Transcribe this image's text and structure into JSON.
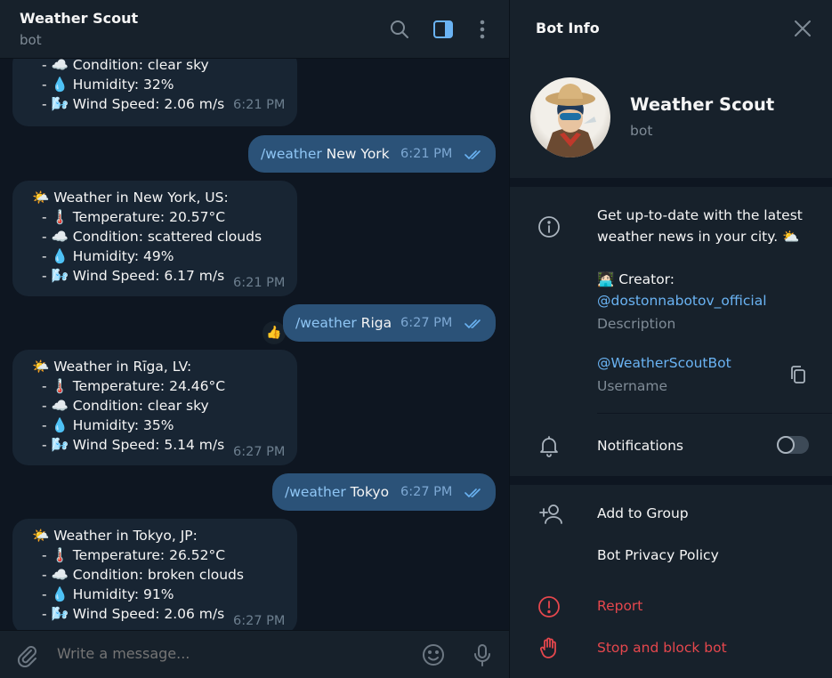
{
  "chat_header": {
    "title": "Weather Scout",
    "subtitle": "bot"
  },
  "messages": {
    "m0": {
      "lines": [
        "- ☁️ Condition: clear sky",
        "- 💧 Humidity: 32%",
        "- 🌬️ Wind Speed: 2.06 m/s"
      ],
      "time": "6:21 PM"
    },
    "m1": {
      "command": "/weather",
      "arg": " New York",
      "time": "6:21 PM"
    },
    "m2": {
      "lines": [
        "🌤️ Weather in New York, US:",
        "- 🌡️ Temperature: 20.57°C",
        "- ☁️ Condition: scattered clouds",
        "- 💧 Humidity: 49%",
        "- 🌬️ Wind Speed: 6.17 m/s"
      ],
      "time": "6:21 PM"
    },
    "m3": {
      "command": "/weather",
      "arg": " Riga",
      "time": "6:27 PM",
      "reaction": "👍"
    },
    "m4": {
      "lines": [
        "🌤️ Weather in Rīga, LV:",
        "- 🌡️ Temperature: 24.46°C",
        "- ☁️ Condition: clear sky",
        "- 💧 Humidity: 35%",
        "- 🌬️ Wind Speed: 5.14 m/s"
      ],
      "time": "6:27 PM"
    },
    "m5": {
      "command": "/weather",
      "arg": " Tokyo",
      "time": "6:27 PM"
    },
    "m6": {
      "lines": [
        "🌤️ Weather in Tokyo, JP:",
        "- 🌡️ Temperature: 26.52°C",
        "- ☁️ Condition: broken clouds",
        "- 💧 Humidity: 91%",
        "- 🌬️ Wind Speed: 2.06 m/s"
      ],
      "time": "6:27 PM"
    }
  },
  "composer": {
    "placeholder": "Write a message..."
  },
  "info": {
    "title": "Bot Info",
    "name": "Weather Scout",
    "subtitle": "bot",
    "about_line1": "Get up-to-date with the latest",
    "about_line2": "weather news in your city. ⛅",
    "creator_label": "🧑🏻‍💻 Creator:",
    "creator_handle": "@dostonnabotov_official",
    "description_caption": "Description",
    "username": "@WeatherScoutBot",
    "username_caption": "Username",
    "notifications_label": "Notifications",
    "notifications_enabled": false,
    "add_to_group": "Add to Group",
    "privacy_policy": "Bot Privacy Policy",
    "report": "Report",
    "stop_block": "Stop and block bot"
  },
  "colors": {
    "chat_bg": "#0e1621",
    "panel_bg": "#17212b",
    "incoming_bubble": "#182533",
    "outgoing_bubble": "#2b5278",
    "link": "#6ab3f3",
    "danger": "#e5474d"
  },
  "icons": {
    "header": [
      "search-icon",
      "sidebar-toggle-icon",
      "more-vertical-icon"
    ],
    "composer": [
      "attach-icon",
      "emoji-icon",
      "microphone-icon"
    ],
    "info": [
      "close-icon",
      "info-icon",
      "copy-icon",
      "bell-icon",
      "add-user-icon",
      "alert-circle-icon",
      "hand-stop-icon"
    ]
  }
}
